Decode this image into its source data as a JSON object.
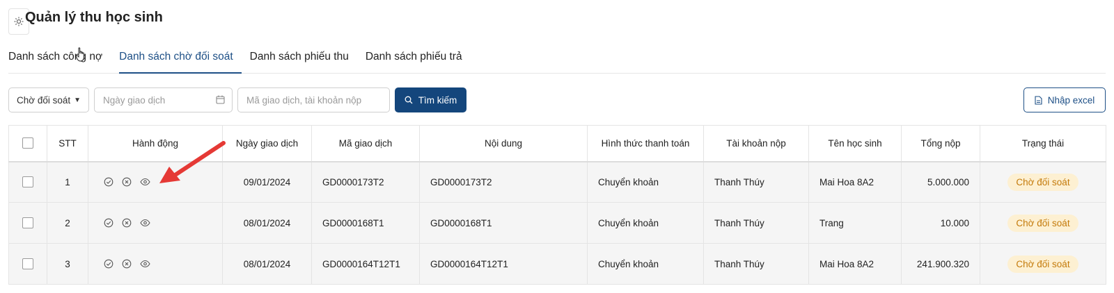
{
  "page": {
    "title": "Quản lý thu học sinh"
  },
  "tabs": [
    {
      "label": "Danh sách công nợ",
      "active": false
    },
    {
      "label": "Danh sách chờ đối soát",
      "active": true
    },
    {
      "label": "Danh sách phiếu thu",
      "active": false
    },
    {
      "label": "Danh sách phiếu trả",
      "active": false
    }
  ],
  "filters": {
    "status_value": "Chờ đối soát",
    "date_placeholder": "Ngày giao dịch",
    "search_placeholder": "Mã giao dịch, tài khoản nộp",
    "search_button": "Tìm kiếm",
    "import_button": "Nhập excel"
  },
  "table": {
    "headers": [
      "STT",
      "Hành động",
      "Ngày giao dịch",
      "Mã giao dịch",
      "Nội dung",
      "Hình thức thanh toán",
      "Tài khoản nộp",
      "Tên học sinh",
      "Tổng nộp",
      "Trạng thái"
    ],
    "rows": [
      {
        "stt": "1",
        "date": "09/01/2024",
        "code": "GD0000173T2",
        "content": "GD0000173T2",
        "method": "Chuyển khoản",
        "account": "Thanh Thúy",
        "student": "Mai Hoa 8A2",
        "total": "5.000.000",
        "status": "Chờ đối soát"
      },
      {
        "stt": "2",
        "date": "08/01/2024",
        "code": "GD0000168T1",
        "content": "GD0000168T1",
        "method": "Chuyển khoản",
        "account": "Thanh Thúy",
        "student": "Trang",
        "total": "10.000",
        "status": "Chờ đối soát"
      },
      {
        "stt": "3",
        "date": "08/01/2024",
        "code": "GD0000164T12T1",
        "content": "GD0000164T12T1",
        "method": "Chuyển khoản",
        "account": "Thanh Thúy",
        "student": "Mai Hoa 8A2",
        "total": "241.900.320",
        "status": "Chờ đối soát"
      }
    ]
  },
  "colors": {
    "primary": "#14467c",
    "active_tab": "#1d4f86",
    "badge_bg": "#fdf0d2",
    "badge_text": "#c47a0a",
    "arrow": "#e53935"
  },
  "icons": [
    "gear-icon",
    "calendar-icon",
    "search-icon",
    "file-icon",
    "check-circle-icon",
    "x-circle-icon",
    "eye-icon"
  ]
}
